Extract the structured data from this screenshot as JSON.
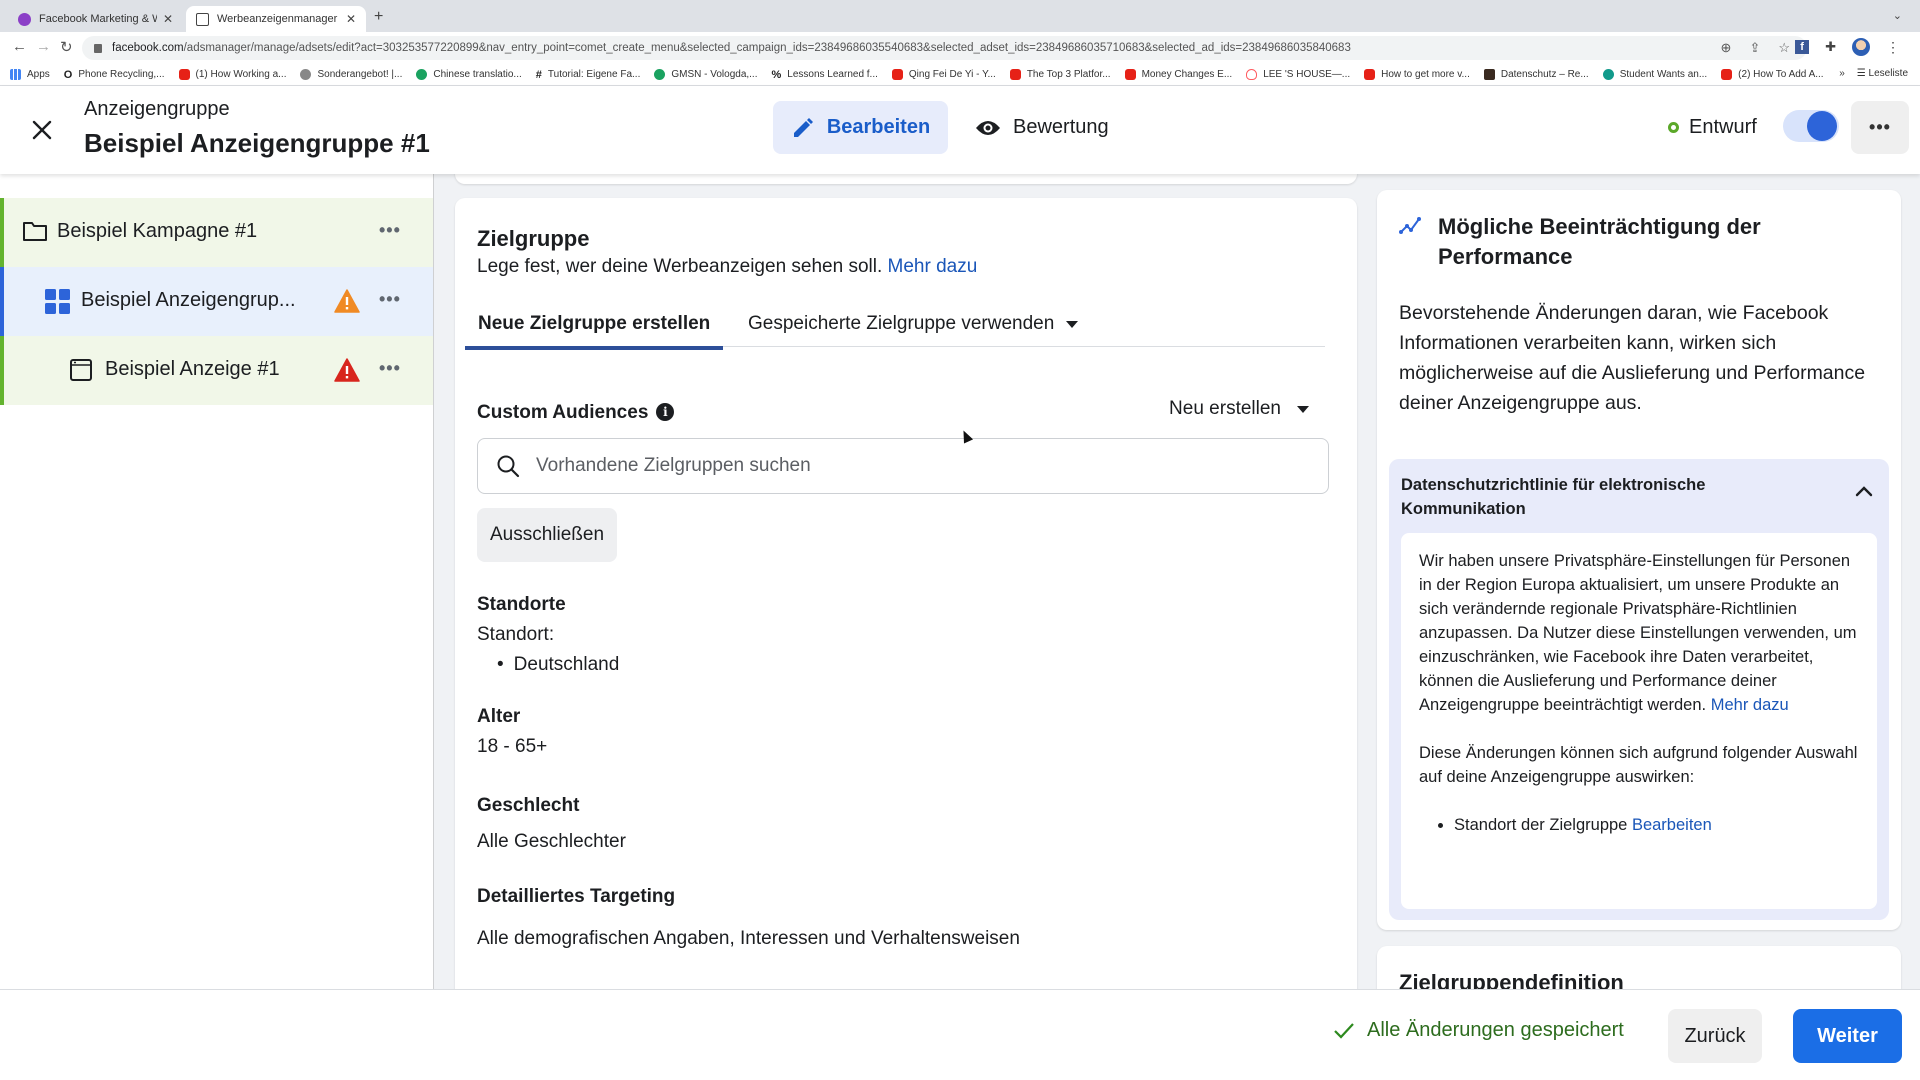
{
  "browser": {
    "tabs": [
      {
        "title": "Facebook Marketing & Werbea",
        "active": false
      },
      {
        "title": "Werbeanzeigenmanager - Wer",
        "active": true
      }
    ],
    "new_tab": "+",
    "url_host": "facebook.com",
    "url_path": "/adsmanager/manage/adsets/edit?act=303253577220899&nav_entry_point=comet_create_menu&selected_campaign_ids=23849686035540683&selected_adset_ids=23849686035710683&selected_ad_ids=23849686035840683",
    "bookmarks": [
      {
        "label": "Apps",
        "icon": "apps-grid-icon"
      },
      {
        "label": "Phone Recycling,...",
        "icon": "o2-icon"
      },
      {
        "label": "(1) How Working a...",
        "icon": "youtube-icon"
      },
      {
        "label": "Sonderangebot! |...",
        "icon": "check-circle-icon"
      },
      {
        "label": "Chinese translatio...",
        "icon": "green-circle-icon"
      },
      {
        "label": "Tutorial: Eigene Fa...",
        "icon": "hash-icon"
      },
      {
        "label": "GMSN - Vologda,...",
        "icon": "upwork-icon"
      },
      {
        "label": "Lessons Learned f...",
        "icon": "percent-icon"
      },
      {
        "label": "Qing Fei De Yi - Y...",
        "icon": "youtube-icon"
      },
      {
        "label": "The Top 3 Platfor...",
        "icon": "youtube-icon"
      },
      {
        "label": "Money Changes E...",
        "icon": "youtube-icon"
      },
      {
        "label": "LEE 'S HOUSE—...",
        "icon": "airbnb-icon"
      },
      {
        "label": "How to get more v...",
        "icon": "youtube-icon"
      },
      {
        "label": "Datenschutz – Re...",
        "icon": "image-icon"
      },
      {
        "label": "Student Wants an...",
        "icon": "teal-circle-icon"
      },
      {
        "label": "(2) How To Add A...",
        "icon": "youtube-icon"
      }
    ],
    "more_bookmarks": "»",
    "reading_list": "Leseliste"
  },
  "header": {
    "subtitle": "Anzeigengruppe",
    "title": "Beispiel Anzeigengruppe #1",
    "edit_label": "Bearbeiten",
    "review_label": "Bewertung",
    "status_label": "Entwurf",
    "toggle_on": true,
    "more_label": "•••"
  },
  "tree": {
    "items": [
      {
        "label": "Beispiel Kampagne #1",
        "icon": "folder-icon",
        "warning": null
      },
      {
        "label": "Beispiel Anzeigengrup...",
        "icon": "grid-icon",
        "warning": "orange"
      },
      {
        "label": "Beispiel Anzeige #1",
        "icon": "ad-icon",
        "warning": "red"
      }
    ],
    "more_label": "•••"
  },
  "audience": {
    "title": "Zielgruppe",
    "description": "Lege fest, wer deine Werbeanzeigen sehen soll.",
    "learn_more": "Mehr dazu",
    "tabs": [
      {
        "label": "Neue Zielgruppe erstellen",
        "active": true
      },
      {
        "label": "Gespeicherte Zielgruppe verwenden",
        "active": false
      }
    ],
    "custom_audiences_label": "Custom Audiences",
    "create_new_label": "Neu erstellen",
    "search_placeholder": "Vorhandene Zielgruppen suchen",
    "exclude_label": "Ausschließen",
    "locations_title": "Standorte",
    "location_label": "Standort:",
    "locations": [
      "Deutschland"
    ],
    "age_title": "Alter",
    "age_value": "18 - 65+",
    "gender_title": "Geschlecht",
    "gender_value": "Alle Geschlechter",
    "targeting_title": "Detailliertes Targeting",
    "targeting_value": "Alle demografischen Angaben, Interessen und Verhaltensweisen"
  },
  "right_panel": {
    "title": "Mögliche Beeinträchtigung der Performance",
    "body": "Bevorstehende Änderungen daran, wie Facebook Informationen verarbeiten kann, wirken sich möglicherweise auf die Auslieferung und Performance deiner Anzeigengruppe aus.",
    "accordion_title": "Datenschutzrichtlinie für elektronische Kommunikation",
    "accordion_text": "Wir haben unsere Privatsphäre-Einstellungen für Personen in der Region Europa aktualisiert, um unsere Produkte an sich verändernde regionale Privatsphäre-Richtlinien anzupassen. Da Nutzer diese Einstellungen verwenden, um einzuschränken, wie Facebook ihre Daten verarbeitet, können die Auslieferung und Performance deiner Anzeigengruppe beeinträchtigt werden.",
    "accordion_link": "Mehr dazu",
    "affects_text": "Diese Änderungen können sich aufgrund folgender Auswahl auf deine Anzeigengruppe auswirken:",
    "affected_item": "Standort der Zielgruppe",
    "affected_item_link": "Bearbeiten",
    "next_card_title": "Zielgruppendefinition"
  },
  "footer": {
    "saved_label": "Alle Änderungen gespeichert",
    "back_label": "Zurück",
    "next_label": "Weiter"
  },
  "colors": {
    "accent": "#1b6ee6",
    "link": "#1a56b8",
    "status_green": "#5ba829",
    "warning_orange": "#f08a24",
    "warning_red": "#d8261d"
  }
}
